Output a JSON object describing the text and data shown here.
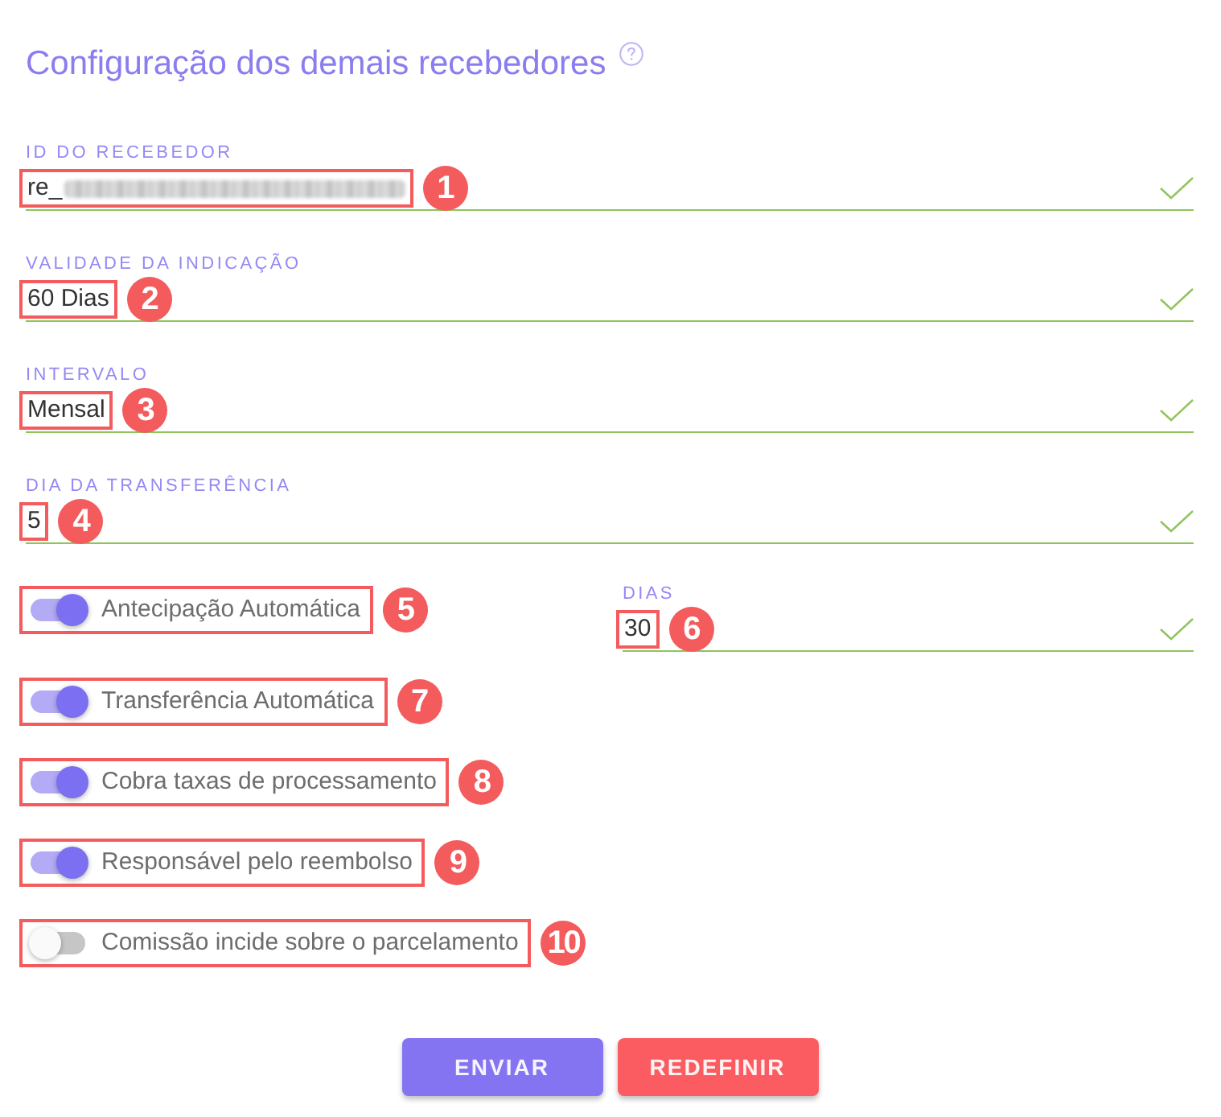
{
  "title": "Configuração dos demais recebedores",
  "fields": [
    {
      "label": "ID DO RECEBEDOR",
      "value": "re_",
      "redacted": true,
      "valid": true,
      "marker": "1"
    },
    {
      "label": "VALIDADE DA INDICAÇÃO",
      "value": "60 Dias",
      "valid": true,
      "marker": "2"
    },
    {
      "label": "INTERVALO",
      "value": "Mensal",
      "valid": true,
      "marker": "3"
    },
    {
      "label": "DIA DA TRANSFERÊNCIA",
      "value": "5",
      "valid": true,
      "marker": "4"
    }
  ],
  "toggles": [
    {
      "label": "Antecipação Automática",
      "on": true,
      "marker": "5"
    },
    {
      "label": "Transferência Automática",
      "on": true,
      "marker": "7"
    },
    {
      "label": "Cobra taxas de processamento",
      "on": true,
      "marker": "8"
    },
    {
      "label": "Responsável pelo reembolso",
      "on": true,
      "marker": "9"
    },
    {
      "label": "Comissão incide sobre o parcelamento",
      "on": false,
      "marker": "10"
    }
  ],
  "days_field": {
    "label": "DIAS",
    "value": "30",
    "valid": true,
    "marker": "6"
  },
  "buttons": [
    {
      "label": "ENVIAR",
      "kind": "primary"
    },
    {
      "label": "REDEFINIR",
      "kind": "reset"
    }
  ]
}
